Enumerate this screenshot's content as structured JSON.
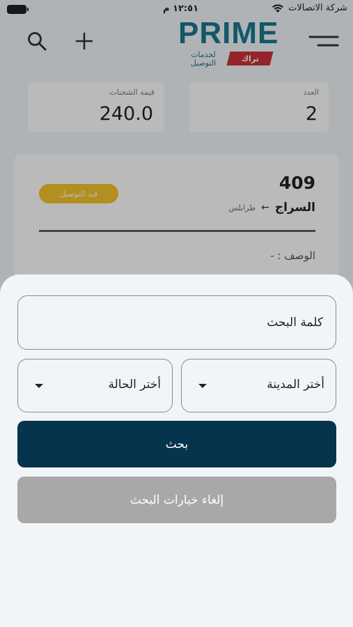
{
  "status_bar": {
    "carrier": "شركة الاتصالات",
    "time": "١٢:٥١ م",
    "icons": [
      "wifi-icon",
      "battery-icon"
    ]
  },
  "header": {
    "logo_text": "PRIME",
    "logo_sub_line1": "لخدمات",
    "logo_sub_line2": "التوصيل",
    "logo_badge": "تراك",
    "icons": [
      "search-icon",
      "plus-icon",
      "menu-icon"
    ]
  },
  "stats": {
    "count_label": "العدد",
    "count_value": "2",
    "value_label": "قيمة الشحنات",
    "value_value": "240.0"
  },
  "order": {
    "id": "409",
    "status": "قيد التوصيل",
    "from": "طرابلس",
    "to": "السراج",
    "description": "الوصف : -"
  },
  "search_sheet": {
    "keyword_placeholder": "كلمة البحث",
    "city_dropdown": "أختر المدينة",
    "status_dropdown": "أختر الحالة",
    "search_button": "بحث",
    "clear_button": "إلغاء خيارات البحث"
  },
  "colors": {
    "brand": "#0a6d88",
    "badge_red": "#c8222a",
    "status_yellow": "#f3c01a",
    "primary_button": "#06344c",
    "disabled_button": "#a8a8a8",
    "background": "#f1f5f8"
  }
}
